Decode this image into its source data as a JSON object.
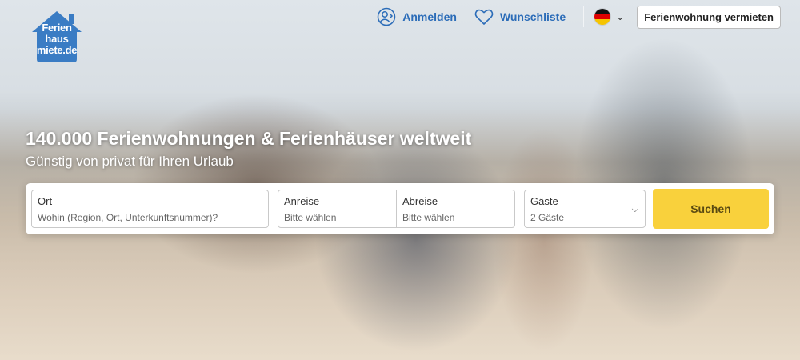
{
  "brand": {
    "logo_text": "Ferien haus miete.de",
    "color": "#3a7cc4"
  },
  "nav": {
    "login_label": "Anmelden",
    "login_icon": "user-login-icon",
    "wishlist_label": "Wunschliste",
    "wishlist_icon": "heart-icon",
    "language_icon": "germany-flag-icon",
    "cta_label": "Ferienwohnung vermieten",
    "link_color": "#2b6cb8"
  },
  "hero": {
    "headline": "140.000 Ferienwohnungen & Ferienhäuser weltweit",
    "subline": "Günstig von privat für Ihren Urlaub"
  },
  "search": {
    "location": {
      "label": "Ort",
      "placeholder": "Wohin (Region, Ort, Unterkunftsnummer)?"
    },
    "checkin": {
      "label": "Anreise",
      "value": "Bitte wählen"
    },
    "checkout": {
      "label": "Abreise",
      "value": "Bitte wählen"
    },
    "guests": {
      "label": "Gäste",
      "value": "2 Gäste"
    },
    "submit_label": "Suchen",
    "submit_color": "#f9d13c"
  }
}
